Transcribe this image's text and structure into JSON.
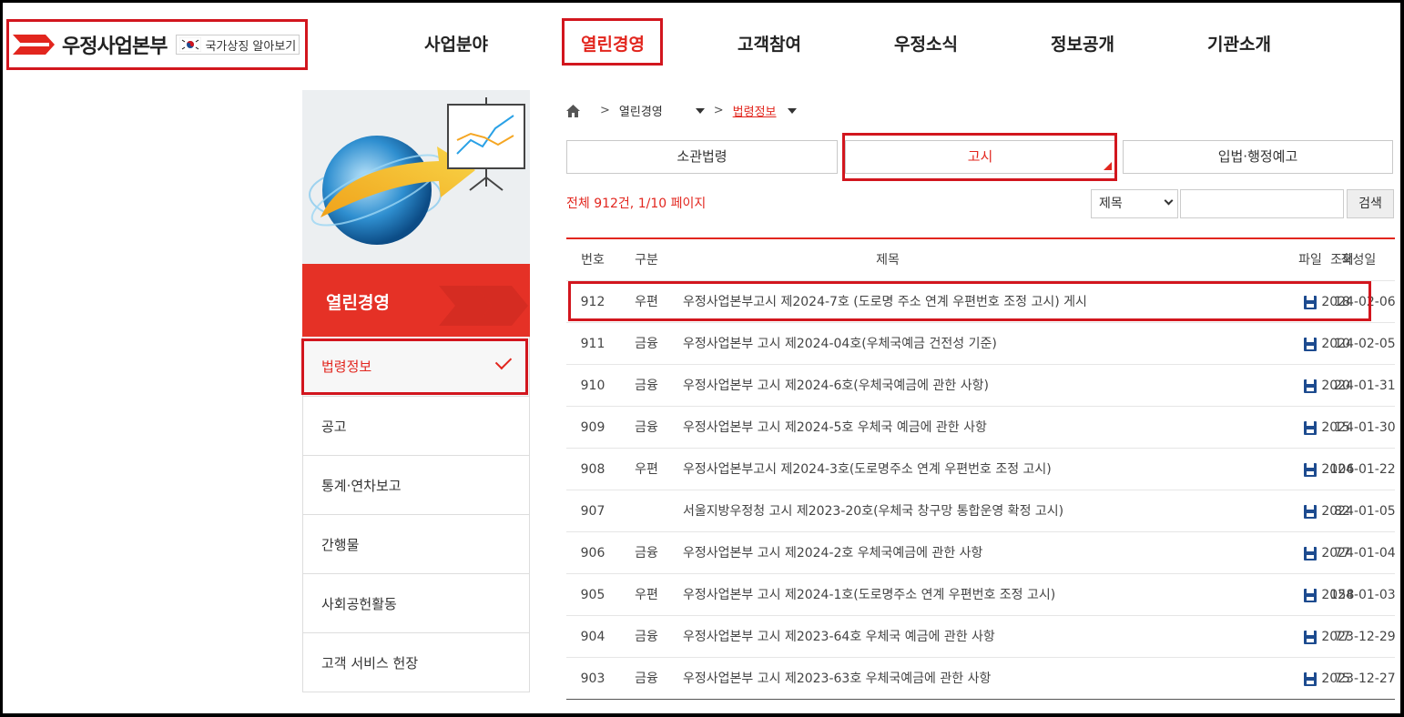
{
  "header": {
    "logo_text": "우정사업본부",
    "flag_label": "국가상징 알아보기",
    "nav": [
      "사업분야",
      "열린경영",
      "고객참여",
      "우정소식",
      "정보공개",
      "기관소개"
    ],
    "active_nav": "열린경영"
  },
  "sidebar": {
    "title": "열린경영",
    "items": [
      {
        "label": "법령정보",
        "active": true
      },
      {
        "label": "공고"
      },
      {
        "label": "통계·연차보고"
      },
      {
        "label": "간행물"
      },
      {
        "label": "사회공헌활동"
      },
      {
        "label": "고객 서비스 헌장"
      }
    ]
  },
  "breadcrumb": {
    "level1": "열린경영",
    "level2": "법령정보"
  },
  "tabs": [
    "소관법령",
    "고시",
    "입법·행정예고"
  ],
  "active_tab": "고시",
  "summary": "전체 912건, 1/10 페이지",
  "search": {
    "select_value": "제목",
    "input_value": "",
    "button": "검색"
  },
  "table": {
    "headers": {
      "no": "번호",
      "cat": "구분",
      "title": "제목",
      "file": "파일",
      "date": "작성일",
      "views": "조회"
    },
    "rows": [
      {
        "no": "912",
        "cat": "우편",
        "title": "우정사업본부고시 제2024-7호 (도로명 주소 연계 우편번호 조정 고시) 게시",
        "date": "2024-02-06",
        "views": "18"
      },
      {
        "no": "911",
        "cat": "금융",
        "title": "우정사업본부 고시 제2024-04호(우체국예금 건전성 기준)",
        "date": "2024-02-05",
        "views": "10"
      },
      {
        "no": "910",
        "cat": "금융",
        "title": "우정사업본부 고시 제2024-6호(우체국예금에 관한 사항)",
        "date": "2024-01-31",
        "views": "20"
      },
      {
        "no": "909",
        "cat": "금융",
        "title": "우정사업본부 고시 제2024-5호 우체국 예금에 관한 사항",
        "date": "2024-01-30",
        "views": "15"
      },
      {
        "no": "908",
        "cat": "우편",
        "title": "우정사업본부고시 제2024-3호(도로명주소 연계 우편번호 조정 고시)",
        "date": "2024-01-22",
        "views": "106"
      },
      {
        "no": "907",
        "cat": "",
        "title": "서울지방우정청 고시 제2023-20호(우체국 창구망 통합운영 확정 고시)",
        "date": "2024-01-05",
        "views": "82"
      },
      {
        "no": "906",
        "cat": "금융",
        "title": "우정사업본부 고시 제2024-2호 우체국예금에 관한 사항",
        "date": "2024-01-04",
        "views": "77"
      },
      {
        "no": "905",
        "cat": "우편",
        "title": "우정사업본부 고시 제2024-1호(도로명주소 연계 우편번호 조정 고시)",
        "date": "2024-01-03",
        "views": "158"
      },
      {
        "no": "904",
        "cat": "금융",
        "title": "우정사업본부 고시 제2023-64호 우체국 예금에 관한 사항",
        "date": "2023-12-29",
        "views": "77"
      },
      {
        "no": "903",
        "cat": "금융",
        "title": "우정사업본부 고시 제2023-63호 우체국예금에 관한 사항",
        "date": "2023-12-27",
        "views": "75"
      }
    ]
  },
  "colors": {
    "accent": "#e2261e",
    "sidebar_title_bg": "#e53126",
    "file_icon": "#1d4b8f"
  }
}
